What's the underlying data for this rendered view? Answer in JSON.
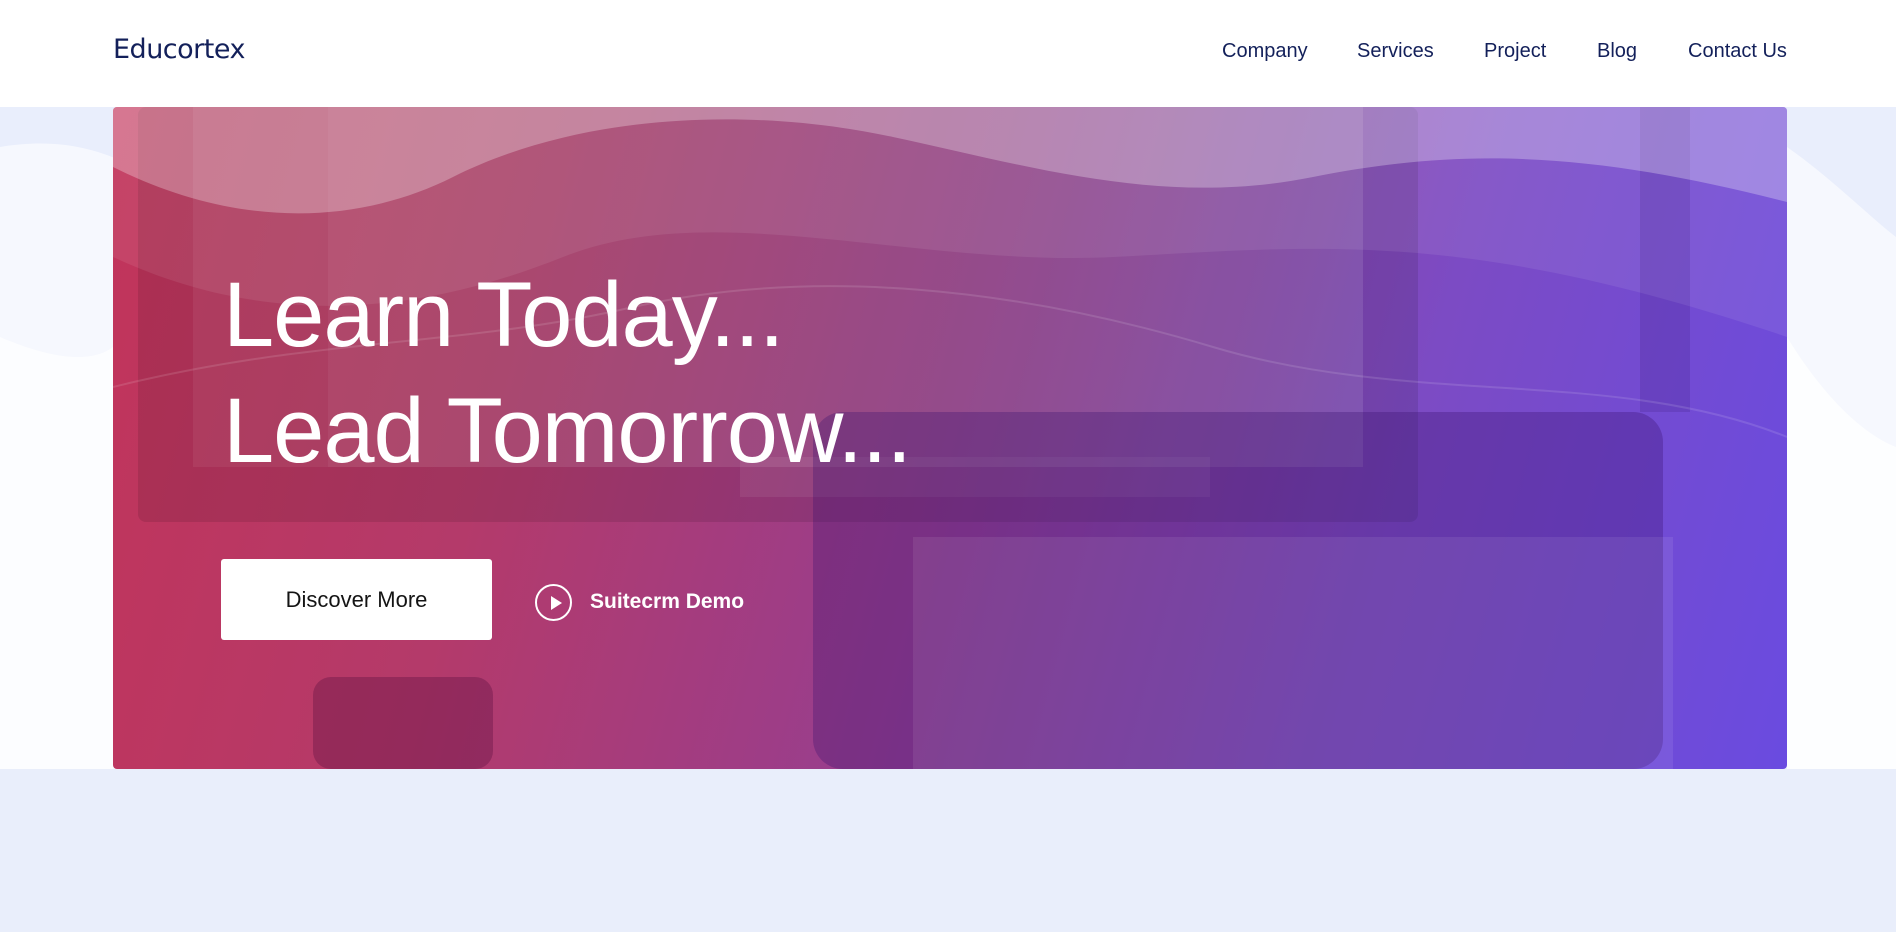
{
  "header": {
    "logo_text": "Educortex",
    "nav": [
      {
        "label": "Company"
      },
      {
        "label": "Services"
      },
      {
        "label": "Project"
      },
      {
        "label": "Blog"
      },
      {
        "label": "Contact Us"
      }
    ]
  },
  "hero": {
    "headline_line1": "Learn Today...",
    "headline_line2": "Lead Tomorrow...",
    "primary_button": "Discover More",
    "secondary_link": "Suitecrm Demo",
    "secondary_icon": "play-icon"
  },
  "colors": {
    "brand_text": "#13205a",
    "hero_gradient_start": "#c2345a",
    "hero_gradient_end": "#6a4be0",
    "band_background": "#e9eefc"
  }
}
